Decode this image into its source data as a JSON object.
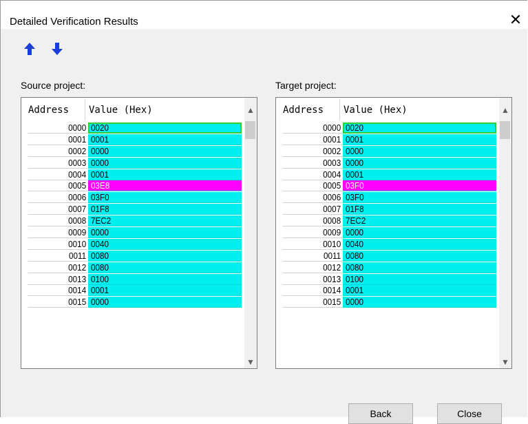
{
  "window": {
    "title": "Detailed Verification Results",
    "close_icon": "close-icon"
  },
  "toolbar": {
    "up_icon": "arrow-up-icon",
    "down_icon": "arrow-down-icon",
    "arrow_color": "#1a3fd6"
  },
  "source": {
    "label": "Source project:",
    "col_address": "Address",
    "col_value": "Value (Hex)",
    "rows": [
      {
        "address": "0000",
        "value": "0020",
        "state": "selected"
      },
      {
        "address": "0001",
        "value": "0001",
        "state": "normal"
      },
      {
        "address": "0002",
        "value": "0000",
        "state": "normal"
      },
      {
        "address": "0003",
        "value": "0000",
        "state": "normal"
      },
      {
        "address": "0004",
        "value": "0001",
        "state": "normal"
      },
      {
        "address": "0005",
        "value": "03E8",
        "state": "diff"
      },
      {
        "address": "0006",
        "value": "03F0",
        "state": "normal"
      },
      {
        "address": "0007",
        "value": "01F8",
        "state": "normal"
      },
      {
        "address": "0008",
        "value": "7EC2",
        "state": "normal"
      },
      {
        "address": "0009",
        "value": "0000",
        "state": "normal"
      },
      {
        "address": "0010",
        "value": "0040",
        "state": "normal"
      },
      {
        "address": "0011",
        "value": "0080",
        "state": "normal"
      },
      {
        "address": "0012",
        "value": "0080",
        "state": "normal"
      },
      {
        "address": "0013",
        "value": "0100",
        "state": "normal"
      },
      {
        "address": "0014",
        "value": "0001",
        "state": "normal"
      },
      {
        "address": "0015",
        "value": "0000",
        "state": "normal"
      }
    ]
  },
  "target": {
    "label": "Target project:",
    "col_address": "Address",
    "col_value": "Value (Hex)",
    "rows": [
      {
        "address": "0000",
        "value": "0020",
        "state": "selected"
      },
      {
        "address": "0001",
        "value": "0001",
        "state": "normal"
      },
      {
        "address": "0002",
        "value": "0000",
        "state": "normal"
      },
      {
        "address": "0003",
        "value": "0000",
        "state": "normal"
      },
      {
        "address": "0004",
        "value": "0001",
        "state": "normal"
      },
      {
        "address": "0005",
        "value": "03F0",
        "state": "diff"
      },
      {
        "address": "0006",
        "value": "03F0",
        "state": "normal"
      },
      {
        "address": "0007",
        "value": "01F8",
        "state": "normal"
      },
      {
        "address": "0008",
        "value": "7EC2",
        "state": "normal"
      },
      {
        "address": "0009",
        "value": "0000",
        "state": "normal"
      },
      {
        "address": "0010",
        "value": "0040",
        "state": "normal"
      },
      {
        "address": "0011",
        "value": "0080",
        "state": "normal"
      },
      {
        "address": "0012",
        "value": "0080",
        "state": "normal"
      },
      {
        "address": "0013",
        "value": "0100",
        "state": "normal"
      },
      {
        "address": "0014",
        "value": "0001",
        "state": "normal"
      },
      {
        "address": "0015",
        "value": "0000",
        "state": "normal"
      }
    ]
  },
  "buttons": {
    "back": "Back",
    "close": "Close"
  },
  "colors": {
    "value_cell": "#00f0f0",
    "diff_cell": "#ff00ff",
    "selected_outline": "#33cc33"
  }
}
